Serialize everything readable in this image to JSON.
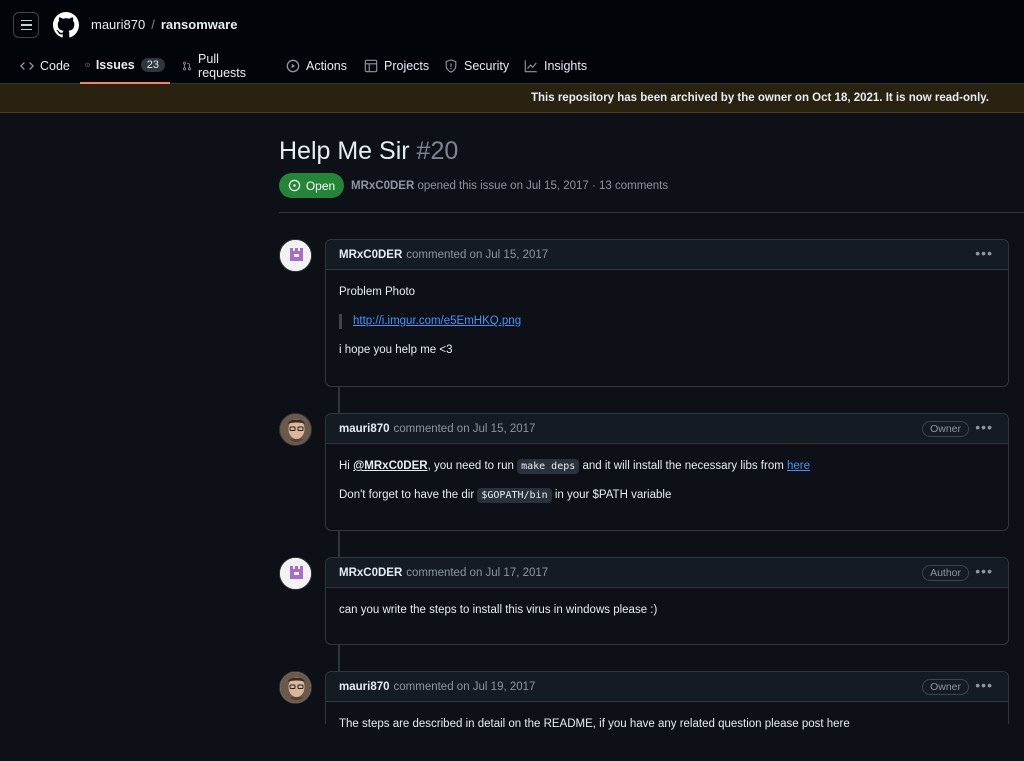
{
  "header": {
    "owner": "mauri870",
    "separator": "/",
    "repo": "ransomware"
  },
  "tabs": {
    "code": "Code",
    "issues": "Issues",
    "issues_count": "23",
    "pulls": "Pull requests",
    "actions": "Actions",
    "projects": "Projects",
    "security": "Security",
    "insights": "Insights"
  },
  "banner": "This repository has been archived by the owner on Oct 18, 2021. It is now read-only.",
  "issue": {
    "title": "Help Me Sir",
    "number": "#20",
    "state": "Open",
    "author": "MRxC0DER",
    "meta": "opened this issue on Jul 15, 2017 · 13 comments"
  },
  "comments": [
    {
      "author": "MRxC0DER",
      "date": "commented on Jul 15, 2017",
      "p1": "Problem Photo",
      "link": "http://i.imgur.com/e5EmHKQ.png",
      "p2": "i hope you help me <3"
    },
    {
      "author": "mauri870",
      "date": "commented on Jul 15, 2017",
      "role": "Owner",
      "hi": "Hi",
      "mention": "@MRxC0DER",
      "t1": ", you need to run",
      "code1": "make deps",
      "t2": "and it will install the necessary libs from",
      "link": "here",
      "t3": "Don't forget to have the dir",
      "code2": "$GOPATH/bin",
      "t4": "in your $PATH variable"
    },
    {
      "author": "MRxC0DER",
      "date": "commented on Jul 17, 2017",
      "role": "Author",
      "p1": "can you write the steps to install this virus in windows please :)"
    },
    {
      "author": "mauri870",
      "date": "commented on Jul 19, 2017",
      "role": "Owner",
      "p1": "The steps are described in detail on the README, if you have any related question please post here"
    }
  ],
  "colors": {
    "open_badge": "#238636",
    "link": "#4493f8",
    "active_tab": "#f78166"
  }
}
